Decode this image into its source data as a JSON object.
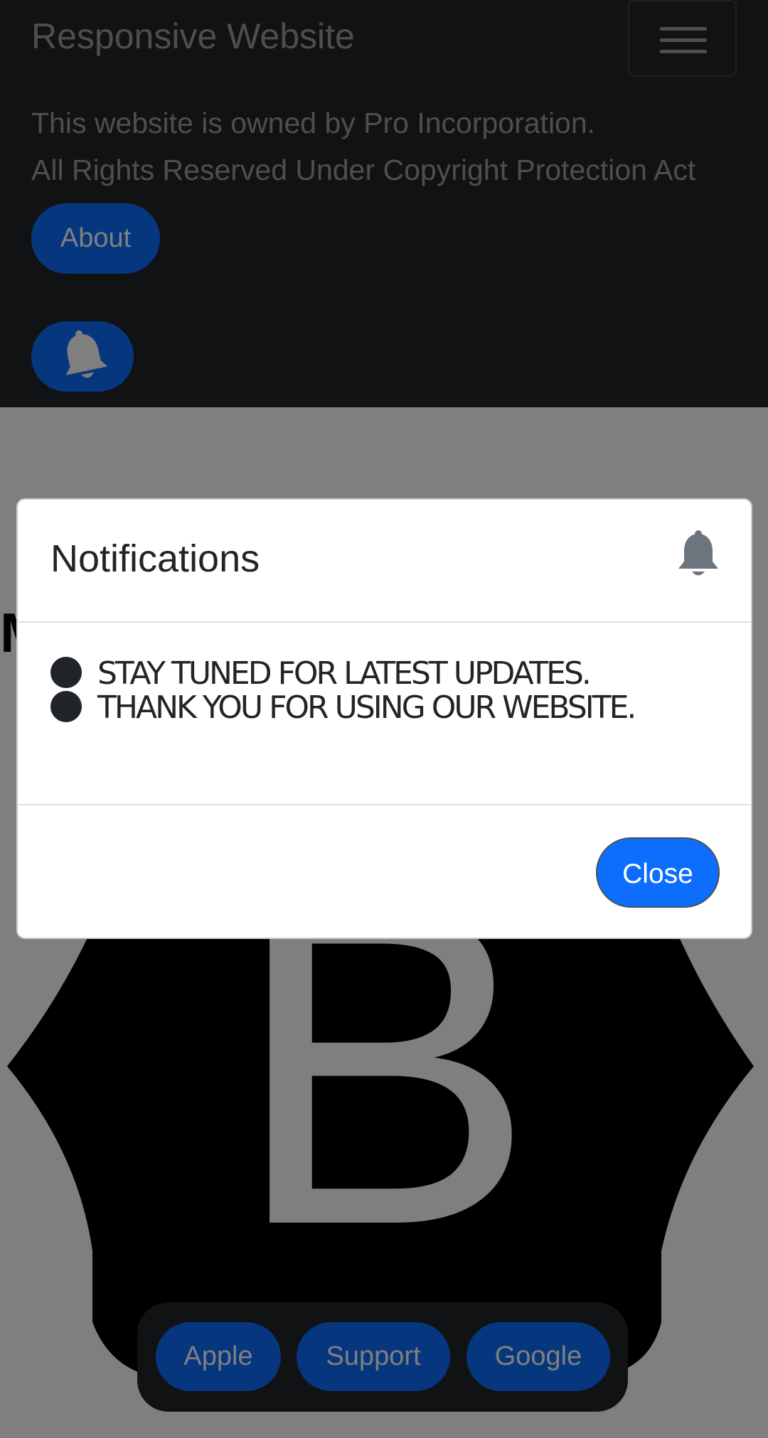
{
  "header": {
    "brand": "Responsive Website",
    "owner_line_1": "This website is owned by Pro Incorporation.",
    "owner_line_2": "All Rights Reserved Under Copyright Protection Act",
    "about_label": "About",
    "menu_icon": "hamburger-menu-icon",
    "bell_icon": "bell-icon"
  },
  "main": {
    "heading_fragment": "M",
    "logo_letter": "B"
  },
  "footer": {
    "links": [
      "Apple",
      "Support",
      "Google"
    ]
  },
  "modal": {
    "title": "Notifications",
    "title_icon": "bell-icon",
    "items": [
      "STAY TUNED FOR LATEST UPDATES.",
      "THANK YOU FOR USING OUR WEBSITE."
    ],
    "close_label": "Close"
  },
  "colors": {
    "navbar_bg": "#212529",
    "primary": "#0d6efd",
    "backdrop": "rgba(0,0,0,0.5)"
  }
}
